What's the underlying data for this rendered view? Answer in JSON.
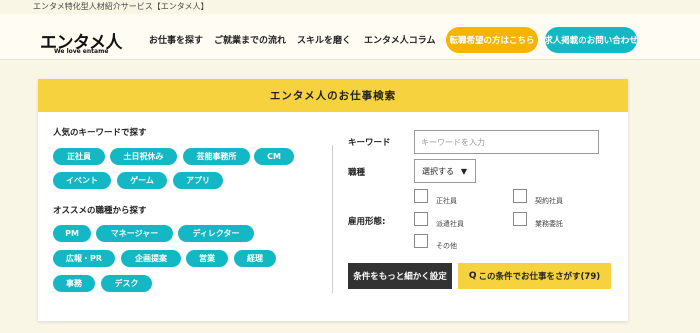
{
  "topbar": {
    "tagline": "エンタメ特化型人材紹介サービス【エンタメ人】"
  },
  "header": {
    "logo_main": "エンタメ人",
    "logo_sub": "We love entame",
    "nav": [
      "お仕事を探す",
      "ご就業までの流れ",
      "スキルを磨く",
      "エンタメ人コラム"
    ],
    "cta_orange": "転職希望の方はこちら",
    "cta_teal": "求人掲載のお問い合わせ"
  },
  "search": {
    "title": "エンタメ人のお仕事検索",
    "popular_title": "人気のキーワードで探す",
    "popular_tags": [
      "正社員",
      "土日祝休み",
      "芸能事務所",
      "CM",
      "イベント",
      "ゲーム",
      "アプリ"
    ],
    "jobtype_title": "オススメの職種から探す",
    "jobtype_tags": [
      "PM",
      "マネージャー",
      "ディレクター",
      "広報・PR",
      "企画提案",
      "営業",
      "経理",
      "事務",
      "デスク"
    ],
    "keyword_label": "キーワード",
    "keyword_placeholder": "キーワードを入力",
    "keyword_value": "",
    "jobtype_label": "職種",
    "jobtype_selected": "選択する",
    "employment_label": "雇用形態:",
    "employment_options": [
      "正社員",
      "契約社員",
      "派遣社員",
      "業務委託",
      "その他"
    ],
    "more_button": "条件をもっと細かく設定",
    "search_button": "この条件でお仕事をさがす(79)"
  },
  "colors": {
    "accent_yellow": "#f6d23f",
    "teal": "#14b8c4",
    "orange": "#f6b300"
  },
  "icons": {
    "search_button_icon": "search-icon",
    "select_arrow": "caret-down-icon"
  }
}
